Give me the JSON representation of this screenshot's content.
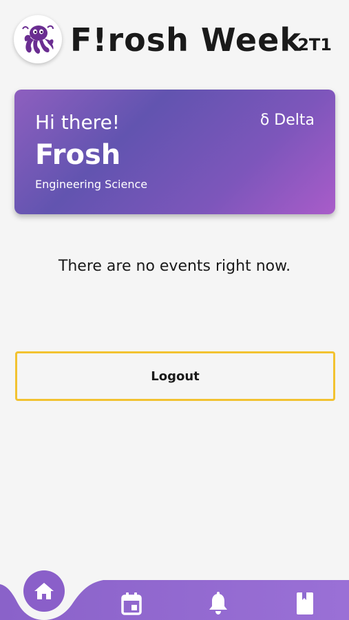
{
  "header": {
    "title": "F!rosh Week",
    "year": "2T1",
    "logo_icon": "octopus-logo-icon"
  },
  "profile_card": {
    "greeting": "Hi there!",
    "name": "Frosh",
    "discipline": "Engineering Science",
    "group": "δ Delta"
  },
  "events": {
    "empty_message": "There are no events right now."
  },
  "logout": {
    "label": "Logout"
  },
  "bottom_nav": {
    "items": [
      {
        "icon": "home-icon",
        "active": true
      },
      {
        "icon": "calendar-icon",
        "active": false
      },
      {
        "icon": "bell-icon",
        "active": false
      },
      {
        "icon": "book-icon",
        "active": false
      }
    ]
  },
  "colors": {
    "background": "#f5f5f5",
    "card_gradient_start": "#6254b0",
    "card_gradient_end": "#a95cc9",
    "nav_purple": "#8e6bd0",
    "logout_border": "#f2c230",
    "logo_purple": "#6a2d91"
  }
}
